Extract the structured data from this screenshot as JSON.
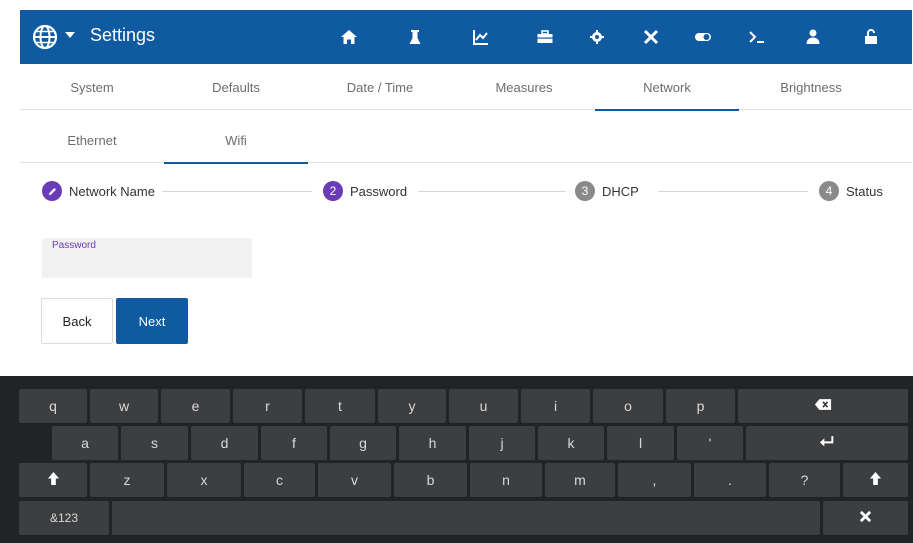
{
  "header": {
    "title": "Settings",
    "accent": "#0f5aa0",
    "icons": [
      "home-icon",
      "flask-icon",
      "chart-icon",
      "toolbox-icon",
      "gear-icon",
      "tools-icon",
      "toggle-icon",
      "terminal-icon",
      "user-icon",
      "unlock-icon"
    ]
  },
  "tabs": [
    {
      "label": "System"
    },
    {
      "label": "Defaults"
    },
    {
      "label": "Date / Time"
    },
    {
      "label": "Measures"
    },
    {
      "label": "Network",
      "active": true
    },
    {
      "label": "Brightness"
    }
  ],
  "subtabs": [
    {
      "label": "Ethernet"
    },
    {
      "label": "Wifi",
      "active": true
    }
  ],
  "stepper": [
    {
      "badge": "",
      "label": "Network Name",
      "state": "done"
    },
    {
      "badge": "2",
      "label": "Password",
      "state": "active"
    },
    {
      "badge": "3",
      "label": "DHCP",
      "state": "pending"
    },
    {
      "badge": "4",
      "label": "Status",
      "state": "pending"
    }
  ],
  "form": {
    "password_label": "Password",
    "password_value": ""
  },
  "buttons": {
    "back": "Back",
    "next": "Next"
  },
  "keyboard": {
    "row1": [
      "q",
      "w",
      "e",
      "r",
      "t",
      "y",
      "u",
      "i",
      "o",
      "p"
    ],
    "row2": [
      "a",
      "s",
      "d",
      "f",
      "g",
      "h",
      "j",
      "k",
      "l",
      "'"
    ],
    "row3": [
      "z",
      "x",
      "c",
      "v",
      "b",
      "n",
      "m",
      ",",
      ".",
      "?"
    ],
    "symbols_label": "&123"
  }
}
